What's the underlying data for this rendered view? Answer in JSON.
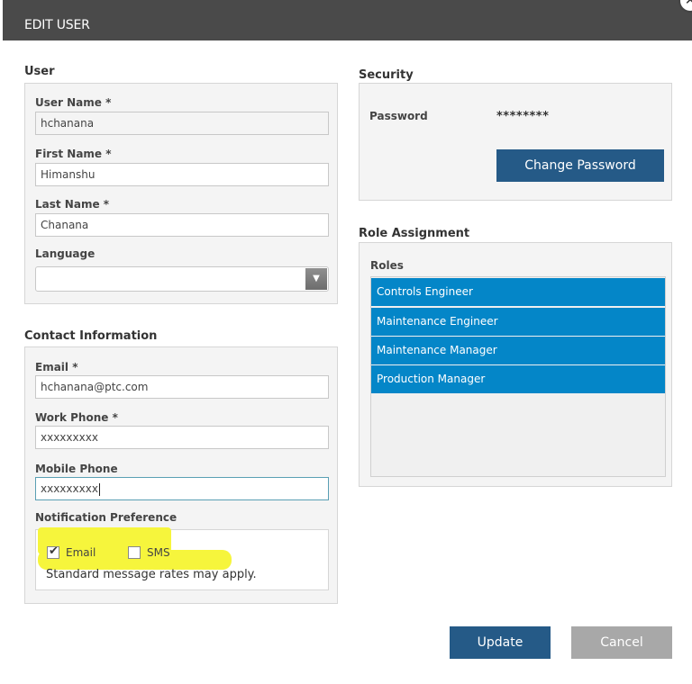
{
  "dialog": {
    "title": "EDIT USER",
    "close_glyph": "✕"
  },
  "user": {
    "section_title": "User",
    "username_label": "User Name *",
    "username_value": "hchanana",
    "firstname_label": "First Name *",
    "firstname_value": "Himanshu",
    "lastname_label": "Last Name *",
    "lastname_value": "Chanana",
    "language_label": "Language",
    "language_value": "",
    "dropdown_glyph": "▼"
  },
  "contact": {
    "section_title": "Contact Information",
    "email_label": "Email *",
    "email_value": "hchanana@ptc.com",
    "workphone_label": "Work Phone *",
    "workphone_value": "xxxxxxxxx",
    "mobilephone_label": "Mobile Phone",
    "mobilephone_value": "xxxxxxxxx",
    "notification_label": "Notification Preference",
    "email_option": {
      "label": "Email",
      "checked": true,
      "glyph": "✔"
    },
    "sms_option": {
      "label": "SMS",
      "checked": false
    },
    "note": "Standard message rates may apply.",
    "highlight_color": "#f6f53c"
  },
  "security": {
    "section_title": "Security",
    "password_label": "Password",
    "password_value": "********",
    "change_password_button": "Change Password"
  },
  "roles": {
    "section_title": "Role Assignment",
    "list_label": "Roles",
    "items": [
      "Controls Engineer",
      "Maintenance Engineer",
      "Maintenance Manager",
      "Production Manager"
    ],
    "selected_color": "#0486c8"
  },
  "footer": {
    "update_button": "Update",
    "cancel_button": "Cancel"
  },
  "colors": {
    "titlebar": "#4a4a4a",
    "primary_button": "#255a87",
    "cancel_button": "#a8a8a8"
  }
}
